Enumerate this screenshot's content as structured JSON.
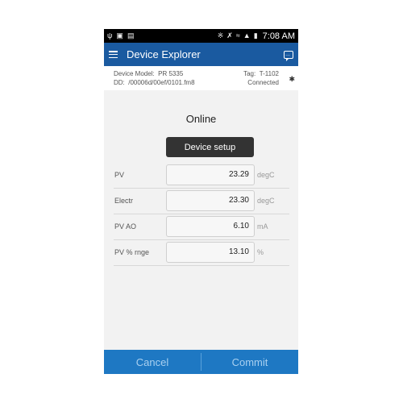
{
  "statusbar": {
    "left_icons": [
      "usb-icon",
      "image-icon",
      "doc-icon"
    ],
    "right_icons": [
      "bluetooth-icon",
      "mute-icon",
      "wifi-icon",
      "signal-icon",
      "battery-icon"
    ],
    "time": "7:08 AM"
  },
  "appbar": {
    "title": "Device Explorer"
  },
  "device": {
    "model_label": "Device Model:",
    "model_value": "PR 5335",
    "dd_label": "DD:",
    "dd_value": "/00006d/00ef/0101.fm8",
    "tag_label": "Tag:",
    "tag_value": "T-1102",
    "status": "Connected"
  },
  "main": {
    "status_heading": "Online",
    "setup_button": "Device setup",
    "rows": [
      {
        "label": "PV",
        "value": "23.29",
        "unit": "degC"
      },
      {
        "label": "Electr",
        "value": "23.30",
        "unit": "degC"
      },
      {
        "label": "PV AO",
        "value": "6.10",
        "unit": "mA"
      },
      {
        "label": "PV % rnge",
        "value": "13.10",
        "unit": "%"
      }
    ]
  },
  "footer": {
    "cancel_label": "Cancel",
    "commit_label": "Commit"
  },
  "colors": {
    "appbar": "#1a5aa0",
    "footer": "#1e78c3",
    "button_dark": "#333333"
  }
}
